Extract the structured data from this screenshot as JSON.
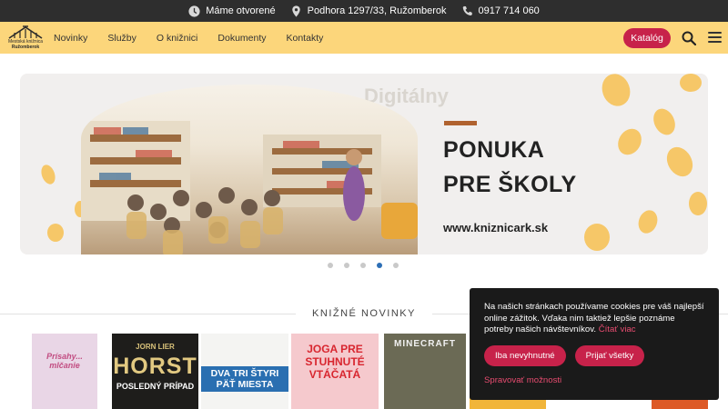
{
  "topbar": {
    "opening": "Máme otvorené",
    "address": "Podhora 1297/33, Ružomberok",
    "phone": "0917 714 060"
  },
  "logo": {
    "line1": "Mestská knižnica",
    "line2": "Ružomberok"
  },
  "nav": {
    "items": [
      "Novinky",
      "Služby",
      "O knižnici",
      "Dokumenty",
      "Kontakty"
    ],
    "catalog": "Katalóg"
  },
  "slider": {
    "title": "PONUKA",
    "subtitle": "PRE ŠKOLY",
    "url": "www.kniznicark.sk",
    "ghost_text": "Digitálny",
    "active_slide": 4,
    "slide_count": 5
  },
  "section": {
    "title": "KNIŽNÉ NOVINKY"
  },
  "books": [
    {
      "title": "Prísahy... mlčanie"
    },
    {
      "author": "JORN LIER",
      "title": "HORST",
      "subtitle": "POSLEDNÝ PRÍPAD"
    },
    {
      "title": "DVA TRI ŠTYRI PÄŤ MIESTA"
    },
    {
      "title": "JOGA PRE STUHNUTÉ VTÁČATÁ"
    },
    {
      "title": "MINECRAFT"
    }
  ],
  "cookie": {
    "text": "Na našich stránkach používame cookies pre váš najlepší online zážitok. Vďaka nim taktiež lepšie poznáme potreby našich návštevníkov.",
    "more": "Čítať viac",
    "necessary": "Iba nevyhnutné",
    "accept_all": "Prijať všetky",
    "manage": "Spravovať možnosti"
  },
  "colors": {
    "nav_bg": "#fcd67b",
    "accent": "#c7224a",
    "topbar_bg": "#2e2e2e",
    "dot_active": "#2d6fb6"
  }
}
